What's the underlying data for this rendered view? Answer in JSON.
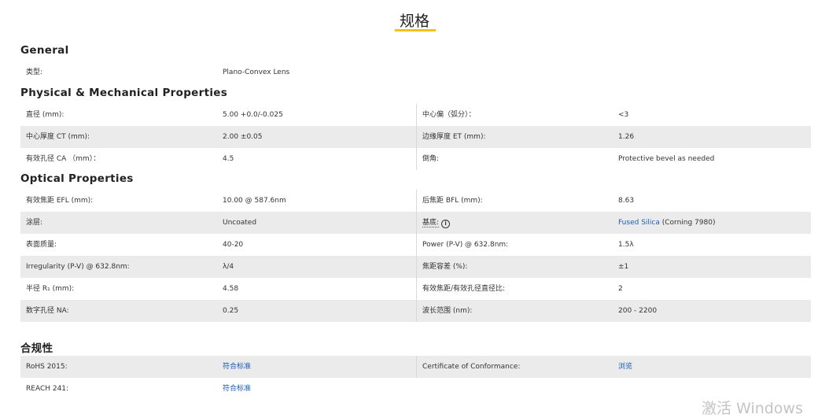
{
  "page": {
    "title": "规格"
  },
  "general": {
    "title": "General",
    "rows": [
      {
        "label": "类型:",
        "value": "Plano-Convex Lens"
      }
    ]
  },
  "physical": {
    "title": "Physical & Mechanical Properties",
    "rows": [
      {
        "label": "直径 (mm):",
        "value": "5.00 +0.0/-0.025",
        "label2": "中心偏（弧分）：",
        "value2": "<3"
      },
      {
        "label": "中心厚度 CT (mm):",
        "value": "2.00 ±0.05",
        "label2": "边缘厚度 ET (mm):",
        "value2": "1.26"
      },
      {
        "label": "有效孔径 CA （mm）：",
        "value": "4.5",
        "label2": "倒角:",
        "value2": "Protective bevel as needed"
      }
    ]
  },
  "optical": {
    "title": "Optical Properties",
    "rows": [
      {
        "label": "有效焦距 EFL (mm):",
        "value": "10.00 @ 587.6nm",
        "label2": "后焦距 BFL (mm):",
        "value2": "8.63"
      },
      {
        "label": "涂层:",
        "value": "Uncoated",
        "label2": "基底:",
        "value2_link": "Fused Silica",
        "value2_suffix": " (Corning 7980)"
      },
      {
        "label": "表面质量:",
        "value": "40-20",
        "label2": "Power (P-V) @ 632.8nm:",
        "value2": "1.5λ"
      },
      {
        "label": "Irregularity (P-V) @ 632.8nm:",
        "value": "λ/4",
        "label2": "焦距容差 (%):",
        "value2": "±1"
      },
      {
        "label": "半径 R₁ (mm):",
        "value": "4.58",
        "label2": "有效焦距/有效孔径直径比:",
        "value2": "2"
      },
      {
        "label": "数字孔径 NA:",
        "value": "0.25",
        "label2": "波长范围 (nm):",
        "value2": "200 - 2200"
      }
    ]
  },
  "compliance": {
    "title": "合规性",
    "rows": [
      {
        "label": "RoHS 2015:",
        "value_link": "符合标准",
        "label2": "Certificate of Conformance:",
        "value2_link": "浏览"
      },
      {
        "label": "REACH 241:",
        "value_link": "符合标准"
      }
    ]
  },
  "icons": {
    "substrate_info": "info-icon"
  },
  "colors": {
    "accent": "#f2c21b",
    "link": "#1a5fb4",
    "row_shade": "#ebebeb"
  },
  "watermark": {
    "text": "激活 Windows"
  }
}
